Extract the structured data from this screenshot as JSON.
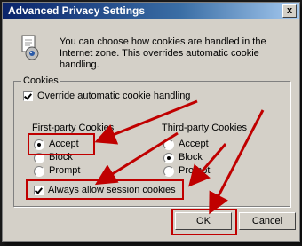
{
  "window": {
    "title": "Advanced Privacy Settings",
    "close_label": "x"
  },
  "intro_text": "You can choose how cookies are handled in the Internet zone.  This overrides automatic cookie handling.",
  "cookies_group": {
    "legend": "Cookies",
    "override_label": "Override automatic cookie handling",
    "override_checked": true,
    "first_party": {
      "title": "First-party Cookies",
      "options": [
        "Accept",
        "Block",
        "Prompt"
      ],
      "selected": "Accept"
    },
    "third_party": {
      "title": "Third-party Cookies",
      "options": [
        "Accept",
        "Block",
        "Prompt"
      ],
      "selected": "Block"
    },
    "session_label": "Always allow session cookies",
    "session_checked": true
  },
  "buttons": {
    "ok": "OK",
    "cancel": "Cancel"
  },
  "colors": {
    "annotation": "#c00000",
    "titlebar": "#0a246a",
    "face": "#d4d0c8"
  }
}
